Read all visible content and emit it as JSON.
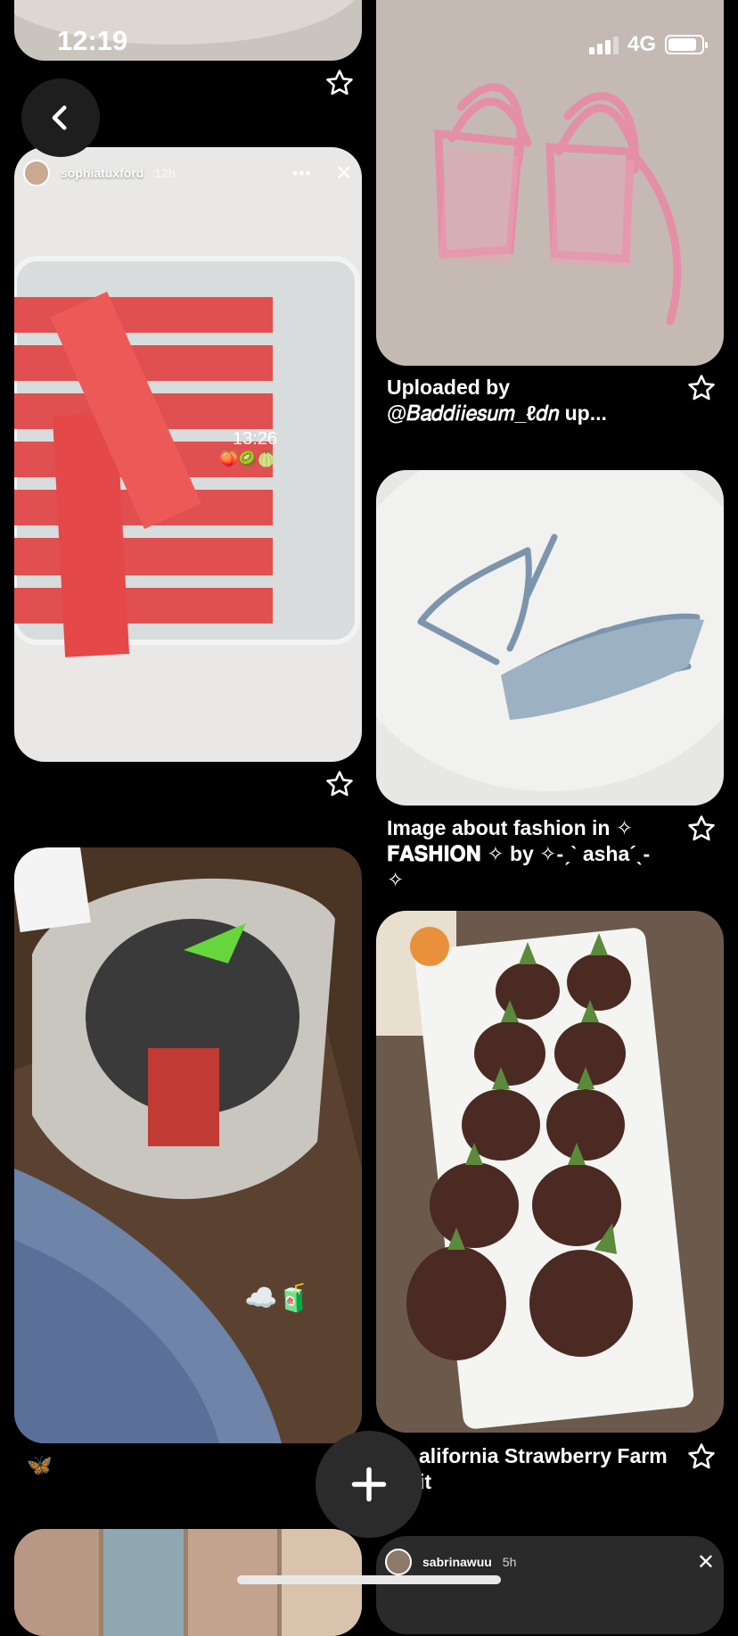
{
  "status_bar": {
    "time": "12:19",
    "network": "4G",
    "battery_level": 0.85
  },
  "nav": {
    "back_icon": "chevron-left-icon",
    "add_icon": "plus-icon"
  },
  "pins": {
    "top_partial": {
      "image": "plate-photo"
    },
    "watermelon": {
      "image": "watermelon-sticks",
      "story_user": "sophiatuxford",
      "story_age": "12h",
      "sticker_time": "13:26",
      "sticker_emojis": "🍑🥝🍈"
    },
    "pink_heels": {
      "image": "pink-strappy-heels",
      "caption": "Uploaded by\n@𝐵𝑎𝑑𝑑𝑖𝑖𝑒𝑠𝑢𝑚_ℓ𝑑𝑛 up..."
    },
    "blue_heels": {
      "image": "blue-strappy-heels",
      "caption": "Image about fashion in ✧\n𝐅𝐀𝐒𝐇𝐈𝐎𝐍 ✧ by ✧-ˏˋ asha´ˎ- ✧"
    },
    "tote_bag": {
      "image": "tote-bag-contents",
      "sticker": "☁️🧃",
      "caption": "🦋"
    },
    "strawberries": {
      "image": "chocolate-strawberries",
      "caption": "alifornia Strawberry Farm\nit"
    },
    "bottom_left": {
      "image": "collage-photos"
    },
    "bottom_right": {
      "story_user": "sabrinawuu",
      "story_age": "5h"
    }
  }
}
